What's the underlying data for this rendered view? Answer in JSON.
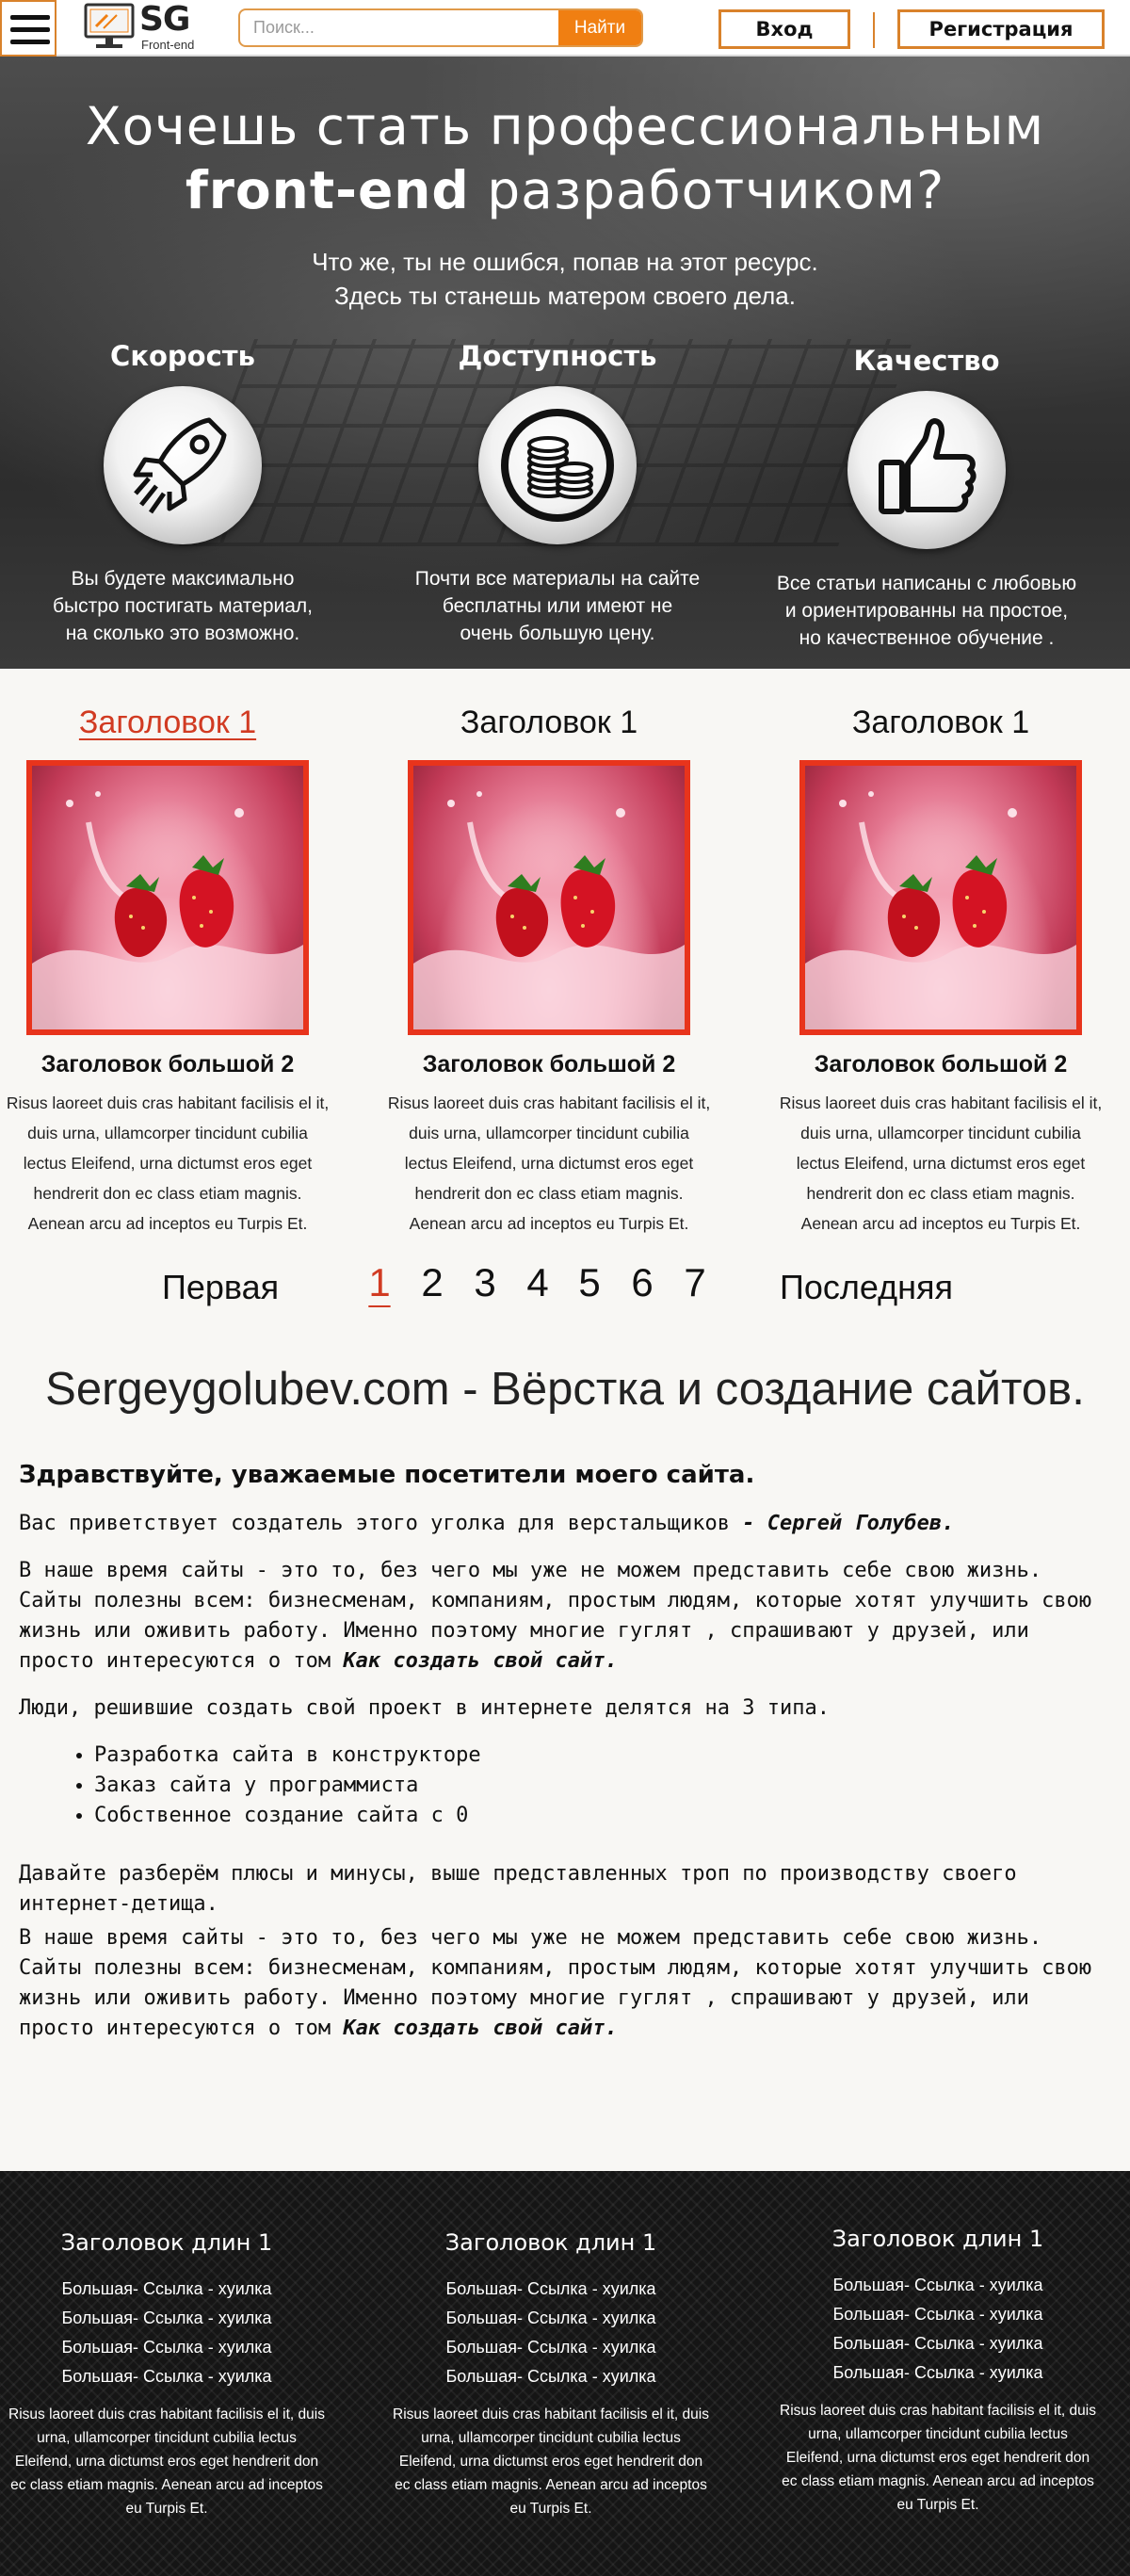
{
  "header": {
    "logo_text": "SG",
    "logo_sub": "Front-end",
    "search_placeholder": "Поиск...",
    "search_button": "Найти",
    "login": "Вход",
    "register": "Регистрация"
  },
  "hero": {
    "title_line1": "Хочешь стать профессиональным",
    "title_bold": "front-end",
    "title_rest": " разработчиком?",
    "subtitle_line1": "Что же, ты не ошибся, попав на этот ресурс.",
    "subtitle_line2": "Здесь ты станешь матером своего дела.",
    "features": [
      {
        "title": "Скорость",
        "icon": "rocket-icon",
        "text_lines": [
          "Вы будете максимально",
          "быстро постигать материал,",
          "на сколько это возможно."
        ]
      },
      {
        "title": "Доступность",
        "icon": "coins-icon",
        "text_lines": [
          "Почти все материалы на сайте",
          "бесплатны или имеют не",
          "очень большую цену."
        ]
      },
      {
        "title": "Качество",
        "icon": "thumbs-up-icon",
        "text_lines": [
          "Все статьи написаны с любовью",
          "и ориентированны на простое,",
          "но качественное обучение ."
        ]
      }
    ]
  },
  "cards": [
    {
      "title": "Заголовок 1",
      "subtitle": "Заголовок большой  2",
      "text": "Risus laoreet duis cras habitant facilisis el it, duis urna, ullamcorper tincidunt cubilia lectus Eleifend, urna dictumst eros eget hendrerit don ec class etiam magnis. Aenean arcu ad inceptos eu Turpis Et."
    },
    {
      "title": "Заголовок 1",
      "subtitle": "Заголовок большой  2",
      "text": "Risus laoreet duis cras habitant facilisis el it, duis urna, ullamcorper tincidunt cubilia lectus Eleifend, urna dictumst eros eget hendrerit don ec class etiam magnis. Aenean arcu ad inceptos eu Turpis Et."
    },
    {
      "title": "Заголовок 1",
      "subtitle": "Заголовок большой  2",
      "text": "Risus laoreet duis cras habitant facilisis el it, duis urna, ullamcorper tincidunt cubilia lectus Eleifend, urna dictumst eros eget hendrerit don ec class etiam magnis. Aenean arcu ad inceptos eu Turpis Et."
    }
  ],
  "pagination": {
    "first": "Первая",
    "pages": [
      "1",
      "2",
      "3",
      "4",
      "5",
      "6",
      "7"
    ],
    "current": "1",
    "last": "Последняя"
  },
  "article": {
    "site_title": "Sergeygolubev.com - Вёрстка и создание сайтов.",
    "heading": "Здравствуйте, уважаемые посетители моего сайта.",
    "greeting": "Вас приветствует создатель этого уголка для верстальщиков ",
    "author": "- Сергей Голубев.",
    "para1": "В наше время сайты - это то, без чего мы уже не можем представить себе свою жизнь. Сайты полезны всем: бизнесменам, компаниям, простым людям, которые хотят улучшить свою жизнь или оживить работу. Именно поэтому многие гуглят , спрашивают у друзей, или  просто интересуются о том ",
    "para1_em": "Как создать свой сайт.",
    "para2": "Люди, решившие создать свой проект в интернете делятся на 3 типа.",
    "list": [
      "Разработка сайта в конструкторе",
      "Заказ сайта у программиста",
      "Собственное создание сайта с 0"
    ],
    "para3": "Давайте разберём плюсы и минусы, выше представленных троп по производству своего интернет-детища.",
    "para4": "В наше время сайты - это то, без чего мы уже не можем представить себе свою жизнь. Сайты полезны всем: бизнесменам, компаниям, простым людям, которые хотят улучшить свою жизнь или оживить работу. Именно поэтому многие гуглят , спрашивают у друзей, или  просто интересуются о том ",
    "para4_em": "Как создать свой сайт."
  },
  "footer": {
    "columns": [
      {
        "title": "Заголовок длин 1",
        "links": [
          "Большая- Ссылка - хуилка",
          "Большая- Ссылка - хуилка",
          "Большая- Ссылка - хуилка",
          "Большая- Ссылка - хуилка"
        ],
        "text": "Risus laoreet duis cras habitant facilisis el it, duis urna, ullamcorper tincidunt cubilia lectus Eleifend, urna dictumst eros eget hendrerit don ec class etiam magnis. Aenean arcu ad inceptos eu Turpis Et."
      },
      {
        "title": "Заголовок длин 1",
        "links": [
          "Большая- Ссылка - хуилка",
          "Большая- Ссылка - хуилка",
          "Большая- Ссылка - хуилка",
          "Большая- Ссылка - хуилка"
        ],
        "text": "Risus laoreet duis cras habitant facilisis el it, duis urna, ullamcorper tincidunt cubilia lectus Eleifend, urna dictumst eros eget hendrerit don ec class etiam magnis. Aenean arcu ad inceptos eu Turpis Et."
      },
      {
        "title": "Заголовок длин 1",
        "links": [
          "Большая- Ссылка - хуилка",
          "Большая- Ссылка - хуилка",
          "Большая- Ссылка - хуилка",
          "Большая- Ссылка - хуилка"
        ],
        "text": "Risus laoreet duis cras habitant facilisis el it, duis urna, ullamcorper tincidunt cubilia lectus Eleifend, urna dictumst eros eget hendrerit don ec class etiam magnis. Aenean arcu ad inceptos eu Turpis Et."
      }
    ]
  },
  "colors": {
    "accent": "#f07f12",
    "border_accent": "#d9822b",
    "active_link": "#d13b22",
    "card_border": "#e8341c",
    "footer_bg": "#151515"
  }
}
